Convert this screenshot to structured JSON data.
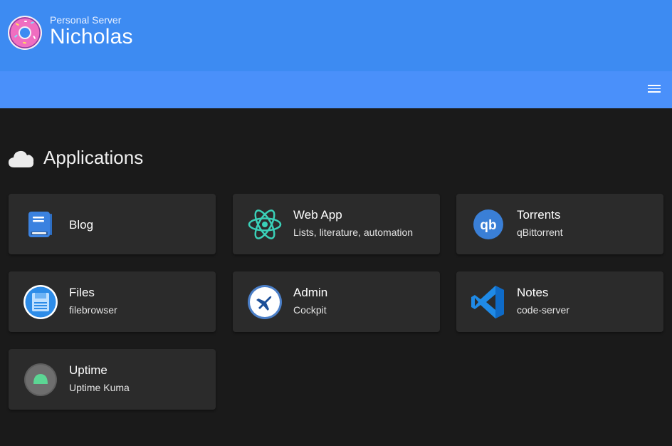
{
  "header": {
    "subtitle": "Personal Server",
    "title": "Nicholas"
  },
  "section": {
    "title": "Applications",
    "icon": "cloud-icon"
  },
  "apps": [
    {
      "name": "Blog",
      "subtitle": "",
      "icon": "book-icon"
    },
    {
      "name": "Web App",
      "subtitle": "Lists, literature, automation",
      "icon": "react-icon"
    },
    {
      "name": "Torrents",
      "subtitle": "qBittorrent",
      "icon": "qbittorrent-icon"
    },
    {
      "name": "Files",
      "subtitle": "filebrowser",
      "icon": "floppy-disk-icon"
    },
    {
      "name": "Admin",
      "subtitle": "Cockpit",
      "icon": "airplane-icon"
    },
    {
      "name": "Notes",
      "subtitle": "code-server",
      "icon": "vscode-icon"
    },
    {
      "name": "Uptime",
      "subtitle": "Uptime Kuma",
      "icon": "uptime-kuma-icon"
    }
  ],
  "colors": {
    "header": "#3d8bf2",
    "navbar": "#4a90fa",
    "background": "#1a1a1a",
    "card": "#2b2b2b"
  }
}
